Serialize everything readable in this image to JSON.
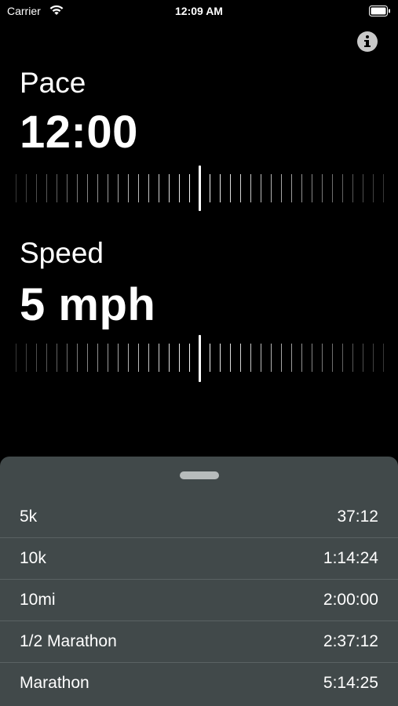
{
  "status_bar": {
    "carrier": "Carrier",
    "time": "12:09 AM",
    "wifi_icon": "wifi-icon",
    "battery_icon": "battery-icon"
  },
  "info_icon": "info-circle-icon",
  "pace": {
    "label": "Pace",
    "value": "12:00"
  },
  "speed": {
    "label": "Speed",
    "value": "5 mph"
  },
  "races": [
    {
      "name": "5k",
      "time": "37:12"
    },
    {
      "name": "10k",
      "time": "1:14:24"
    },
    {
      "name": "10mi",
      "time": "2:00:00"
    },
    {
      "name": "1/2 Marathon",
      "time": "2:37:12"
    },
    {
      "name": "Marathon",
      "time": "5:14:25"
    }
  ],
  "colors": {
    "background": "#000000",
    "sheet": "#41494a",
    "text": "#ffffff"
  }
}
